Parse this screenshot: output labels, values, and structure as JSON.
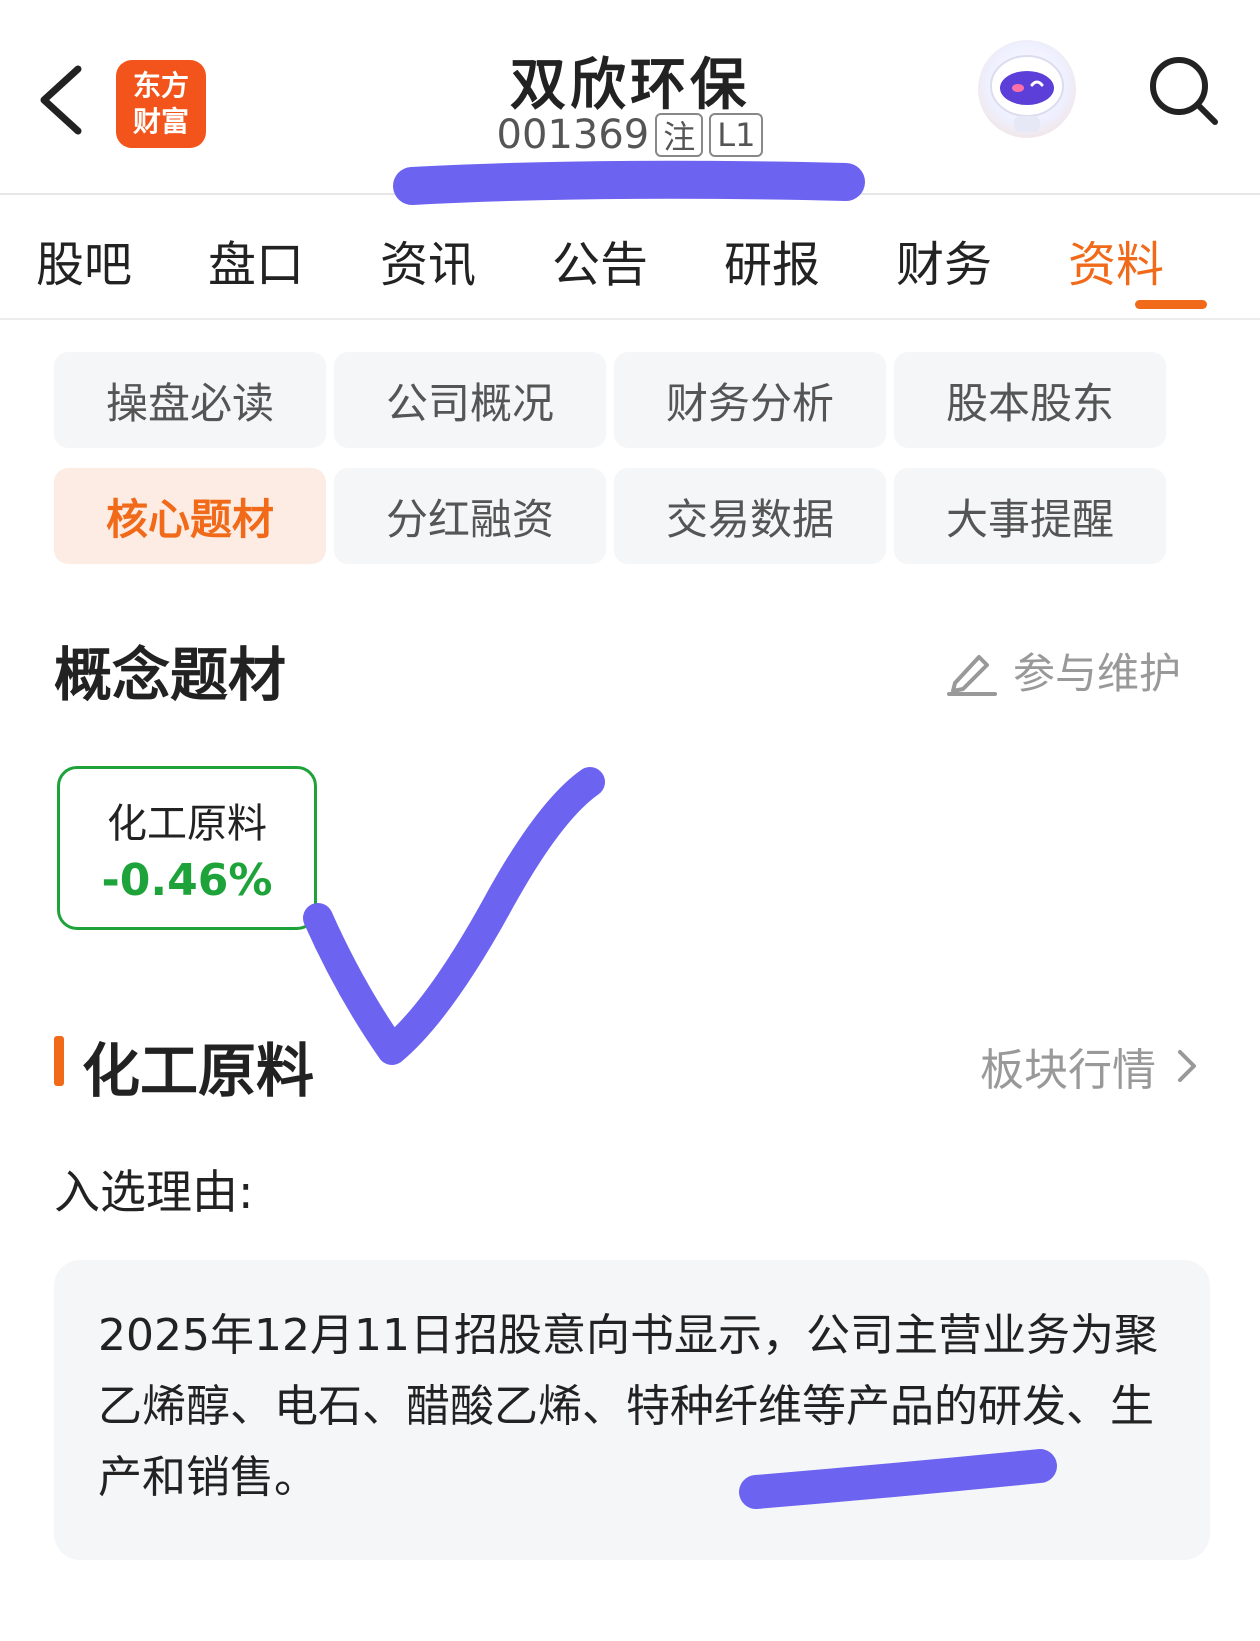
{
  "header": {
    "stock_name": "双欣环保",
    "stock_code": "001369",
    "tag_register": "注",
    "tag_level": "L1",
    "logo_line1": "东方",
    "logo_line2": "财富",
    "brand_color": "#f2541b"
  },
  "tabs": [
    {
      "label": "股吧",
      "active": false
    },
    {
      "label": "盘口",
      "active": false
    },
    {
      "label": "资讯",
      "active": false
    },
    {
      "label": "公告",
      "active": false
    },
    {
      "label": "研报",
      "active": false
    },
    {
      "label": "财务",
      "active": false
    },
    {
      "label": "资料",
      "active": true
    }
  ],
  "subnav": [
    {
      "label": "操盘必读",
      "active": false
    },
    {
      "label": "公司概况",
      "active": false
    },
    {
      "label": "财务分析",
      "active": false
    },
    {
      "label": "股本股东",
      "active": false
    },
    {
      "label": "核心题材",
      "active": true
    },
    {
      "label": "分红融资",
      "active": false
    },
    {
      "label": "交易数据",
      "active": false
    },
    {
      "label": "大事提醒",
      "active": false
    }
  ],
  "concept": {
    "title": "概念题材",
    "maintain_label": "参与维护",
    "card_name": "化工原料",
    "card_change": "-0.46%"
  },
  "section": {
    "title": "化工原料",
    "link_label": "板块行情",
    "reason_label": "入选理由:",
    "reason_text": "2025年12月11日招股意向书显示，公司主营业务为聚乙烯醇、电石、醋酸乙烯、特种纤维等产品的研发、生产和销售。"
  },
  "colors": {
    "accent": "#f06a1a",
    "down_green": "#1ea33a",
    "annotation": "#6c63f0"
  },
  "icons": [
    "back-icon",
    "search-icon",
    "edit-icon",
    "chevron-right-icon",
    "robot-avatar-icon"
  ]
}
